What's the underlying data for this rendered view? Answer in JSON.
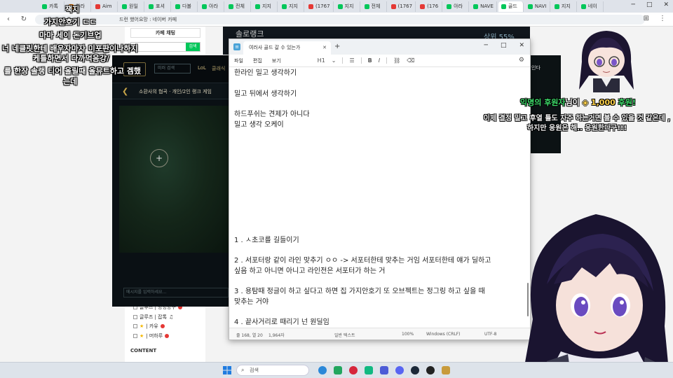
{
  "browser": {
    "tabs": [
      "카톡",
      "아라",
      "Aim",
      "원일",
      "표셔",
      "다볼",
      "아라",
      "전체",
      "지지",
      "지지",
      "(1767",
      "지지",
      "전체",
      "(1767",
      "(176",
      "아라",
      "NAVE",
      "골드",
      "NAVI",
      "지지",
      "네이"
    ],
    "active_tab_index": 17,
    "url": "드런 했어요망 : 네이버 카페",
    "window_controls": [
      "─",
      "□",
      "✕"
    ]
  },
  "cafe": {
    "chat_button": "카페 채팅",
    "search_button": "검색",
    "menu_items": [
      {
        "label": "글루즈 | 방명방구",
        "badge": true
      },
      {
        "label": "글루즈 | 잡톡",
        "badge": false
      },
      {
        "label": "| 카유",
        "badge": true
      },
      {
        "label": "| 머하루",
        "badge": true
      }
    ],
    "content_heading": "CONTENT"
  },
  "lol": {
    "solorank_title": "솔로랭크",
    "solorank_pct": "상위 55%",
    "search_placeholder": "미러 검색",
    "nav_lol": "LoL",
    "nav_classic": "클래식",
    "map_title": "소환사의 협곡 · 개인/2인 랭크 게임",
    "chat_placeholder": "메시지를 입력하세요..."
  },
  "notepad": {
    "tab_title": "여러사 골드 갈 수 있는가",
    "menu": [
      "파일",
      "편집",
      "보기"
    ],
    "heading_select": "H1",
    "format_icons": [
      "list-icon",
      "bold-icon",
      "italic-icon",
      "link-icon",
      "clear-format-icon"
    ],
    "lines": [
      "한라인 밀고 생각하기",
      "",
      "밀고 뒤에서 생각하기",
      "",
      "하드푸쉬는 견제가 아니다",
      "밀고 생각 오케이",
      "1 . ㅅ초코를 길들이기",
      "2 . 서포터랑 같이 라인 맞추기 ㅇㅇ -> 서포터한테 맞추는 거임 서포터한테 얘가 딜하고",
      "싶음 하고 아니면 아니고 라인전은 서포터가 하는 거",
      "3 . 용탐때 정글이 하고 싶다고 하면 집 가지안호기 또 오브젝트는 정그링 하고 싶을 때",
      "맞추는 거야",
      "4 . 끝사거리로 때리기 넌 원딜임"
    ],
    "status": {
      "position": "줄 168, 열 20",
      "chars": "1,964자",
      "format": "일반 텍스트",
      "zoom": "100%",
      "line_ending": "Windows (CRLF)",
      "encoding": "UTF-8"
    }
  },
  "overlay": {
    "chat_lines": [
      "잭지",
      "가지안호기 ㄷㄷ",
      "마마 세이 돈기브업",
      "너 네클릿한테 배우자마자 미포판이나하지",
      "케틀하면서 다까먹음강/",
      "를 한장 솔랭 티어 올릴때 올뮤트하고 겜했",
      "는데"
    ],
    "donation_name": "익명의 후원자",
    "donation_mid": "님이",
    "donation_amount": "1,000",
    "donation_suffix": "후원!",
    "donation_message": "이제 결정 밀고 후열 틀도 자주 하는거면 볼 수 있을 것 같은데 , 하지만 응원은 해.. 응원한다구!!!",
    "right_panel_label": "인다"
  },
  "taskbar": {
    "search_placeholder": "검색",
    "app_icons": [
      "edge-icon",
      "explorer-icon",
      "record-icon",
      "whale-icon",
      "teams-icon",
      "discord-icon",
      "steam-icon",
      "obs-icon",
      "lol-icon"
    ]
  }
}
